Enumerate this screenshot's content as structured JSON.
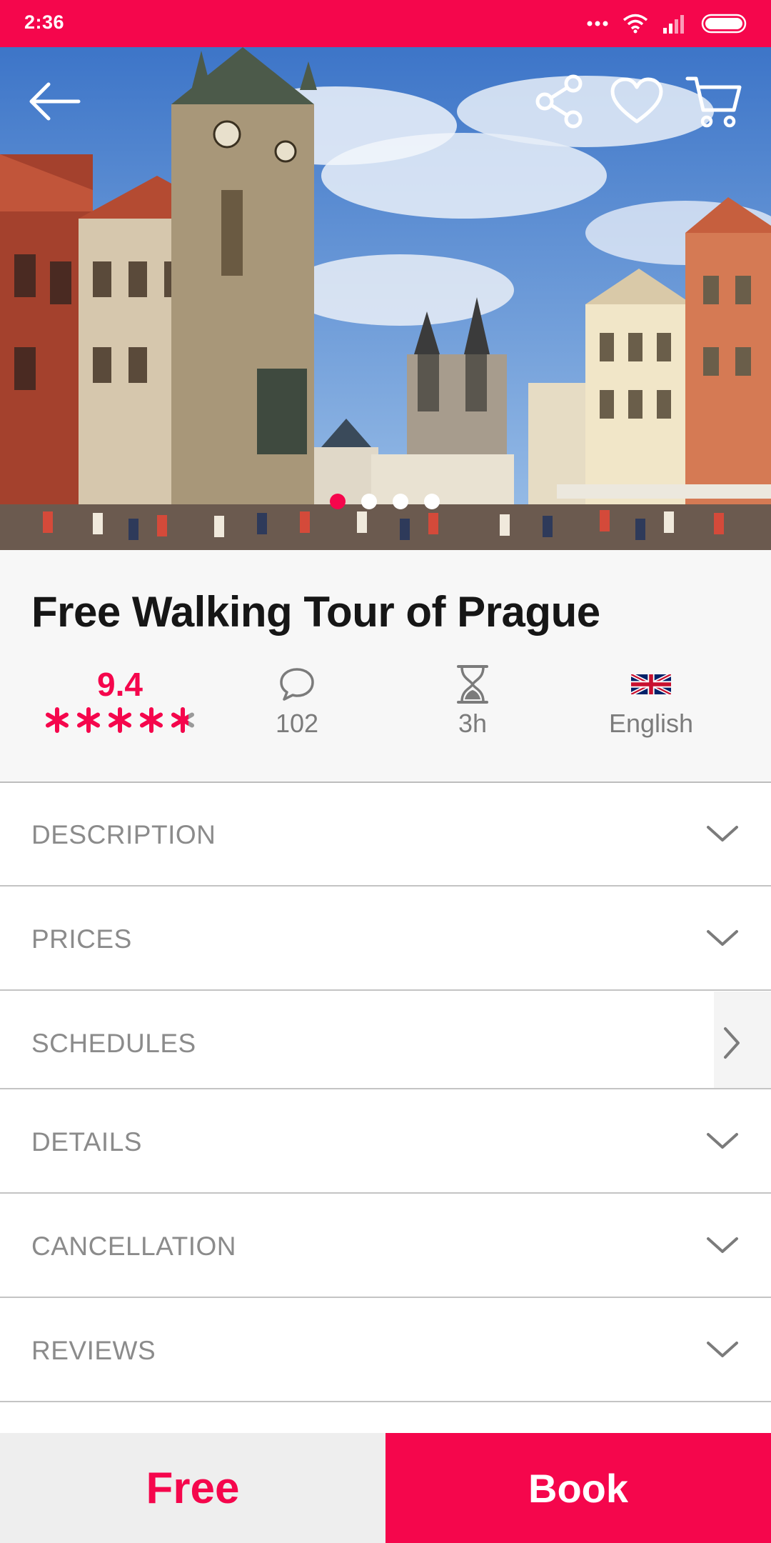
{
  "status_bar": {
    "time": "2:36"
  },
  "hero": {
    "image_alt": "Old Town Square, Prague",
    "slides": 4,
    "active_slide": 1
  },
  "tour": {
    "title": "Free Walking Tour of Prague",
    "rating": "9.4",
    "stars": 4.7,
    "reviews_count": "102",
    "duration": "3h",
    "language": "English"
  },
  "sections": [
    {
      "label": "DESCRIPTION",
      "icon": "chevron-down-icon"
    },
    {
      "label": "PRICES",
      "icon": "chevron-down-icon"
    },
    {
      "label": "SCHEDULES",
      "icon": "chevron-right-icon"
    },
    {
      "label": "DETAILS",
      "icon": "chevron-down-icon"
    },
    {
      "label": "CANCELLATION",
      "icon": "chevron-down-icon"
    },
    {
      "label": "REVIEWS",
      "icon": "chevron-down-icon"
    }
  ],
  "bottom_bar": {
    "price": "Free",
    "book_label": "Book"
  },
  "colors": {
    "accent": "#f5064c",
    "muted_text": "#8b8b8b",
    "title_text": "#161616"
  }
}
